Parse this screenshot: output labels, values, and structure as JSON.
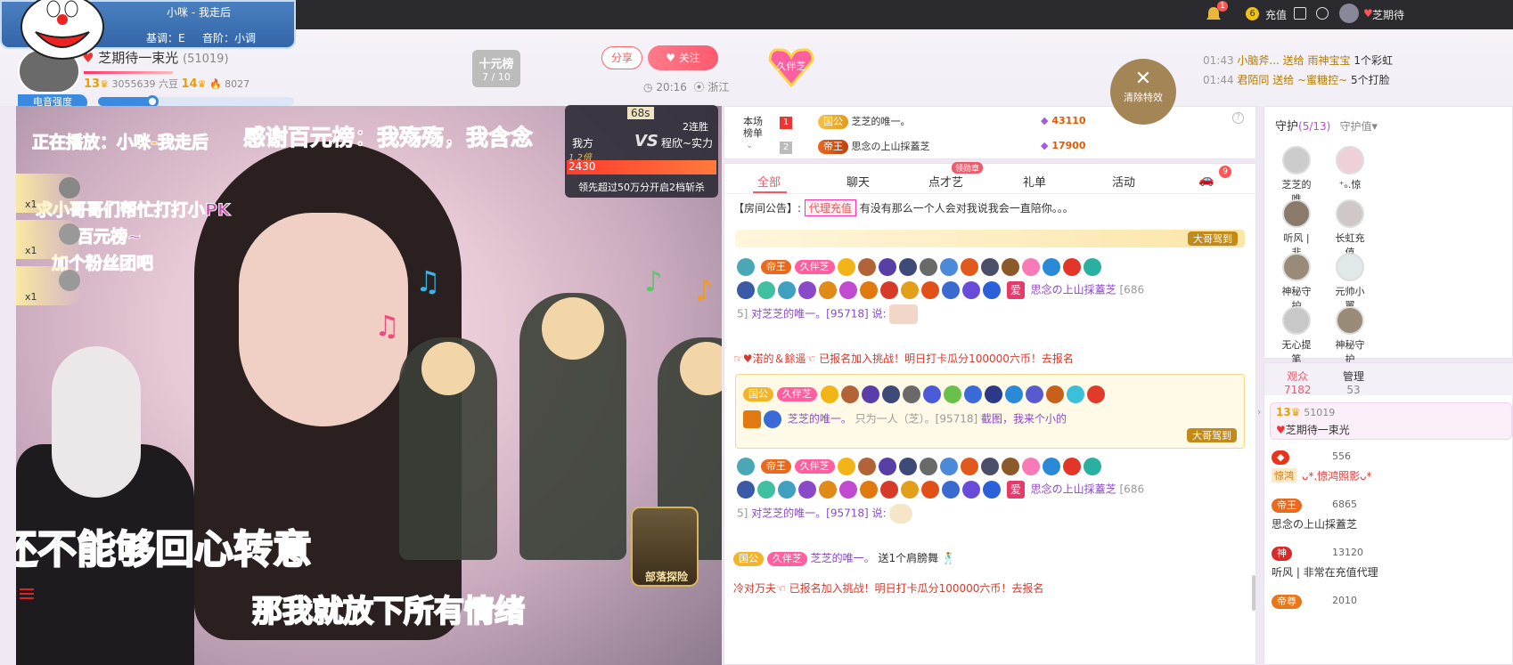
{
  "topbar": {
    "charge": "充值",
    "user": "芝期待",
    "notify_count": "1",
    "coin": "6"
  },
  "song_bubble": {
    "title": "小咪 - 我走后",
    "key": "基调：E",
    "scale": "音阶：小调"
  },
  "anchor": {
    "name": "芝期待一束光",
    "id": "(51019)",
    "level": "13",
    "beans": "3055639 六豆",
    "level2": "14",
    "heat": "8027",
    "mic_label": "电音强度"
  },
  "ranklist": {
    "title": "十元榜",
    "progress": "7 / 10"
  },
  "actions": {
    "share": "分享",
    "follow": "关注",
    "time": "20:16",
    "location": "浙江",
    "fan_badge": "久伴芝"
  },
  "ticker": [
    {
      "time": "01:43",
      "text": "小脑斧... 送给 雨神宝宝",
      "tail": "1个彩虹"
    },
    {
      "time": "01:44",
      "text": "君陌同 送给 ~蜜糖控~",
      "tail": "5个打脸"
    }
  ],
  "clear_effects": "清除特效",
  "pk": {
    "timer": "68s",
    "us": "我方",
    "them": "程欣~实力",
    "streak": "2连胜",
    "multiplier": "1.2倍",
    "score": "2430",
    "tip": "领先超过50万分开启2档斩杀"
  },
  "video": {
    "playing": "正在播放：小咪-我走后",
    "thanks": "感谢百元榜：我殇殇，我含念",
    "lyric1": "还不能够回心转意",
    "lyric2": "那我就放下所有情绪",
    "msg1": "求小哥哥们帮忙打打小PK",
    "msg2": "百元榜~",
    "msg3": "加个粉丝团吧",
    "gift_count": "x1",
    "treasure": "部落探险"
  },
  "rank_board": {
    "label": "本场榜单",
    "rows": [
      {
        "rank": "1",
        "tag": "国公",
        "name": "芝芝的唯一。",
        "value": "43110"
      },
      {
        "rank": "2",
        "tag": "帝王",
        "name": "思念の上山採蓋芝",
        "value": "17900"
      }
    ]
  },
  "tabs": [
    "全部",
    "聊天",
    "点才艺",
    "礼单",
    "活动"
  ],
  "tab_badge": "领勋章",
  "car_count": "9",
  "announce": {
    "label": "【房间公告】:",
    "tag": "代理充值",
    "text": "有没有那么一个人会对我说我会一直陪你。。。"
  },
  "chat": {
    "user1": "思念の上山採蓋芝",
    "user1_id": "[686",
    "user1_id2": "5]",
    "to": "对芝芝的唯一。[95718] 说:",
    "sys1": "☞♥渃的＆餘遥☜ 已报名加入挑战！明日打卡瓜分100000六币！去报名",
    "user2": "芝芝的唯一。",
    "user2_msg": "只为一人（芝）。[95718]",
    "user2_said": "截图，我来个小的",
    "gift_line_user": "芝芝的唯一。",
    "gift_line": "送1个肩膀舞",
    "sys2": "冷对万夫☜ 已报名加入挑战！明日打卡瓜分100000六币！去报名",
    "banner": "大哥驾到",
    "tag_guogong": "国公",
    "tag_diwang": "帝王",
    "tag_jiu": "久伴芝",
    "tag_ai": "爱"
  },
  "guard": {
    "title": "守护",
    "count": "(5/13)",
    "sort": "守护值",
    "members": [
      "芝芝的唯",
      "⁺ₒ.惊",
      "听风 | 非",
      "长虹充值",
      "神秘守护",
      "元帅小翼",
      "无心提笔",
      "神秘守护"
    ]
  },
  "audience": {
    "label": "观众",
    "count": "7182",
    "admin_label": "管理",
    "admin_count": "53"
  },
  "audience_list": [
    {
      "level": "13",
      "id": "51019",
      "name": "芝期待一束光"
    },
    {
      "name": "ᴗ*.惊鸿照影ᴗ*",
      "num": "556",
      "tag": "惊鸿"
    },
    {
      "name": "思念の上山採蓋芝",
      "num": "6865",
      "tag": "帝王"
    },
    {
      "name": "听风 | 非常在充值代理",
      "num": "13120",
      "tag": "神"
    },
    {
      "name": "帝尊",
      "num": "2010"
    }
  ]
}
